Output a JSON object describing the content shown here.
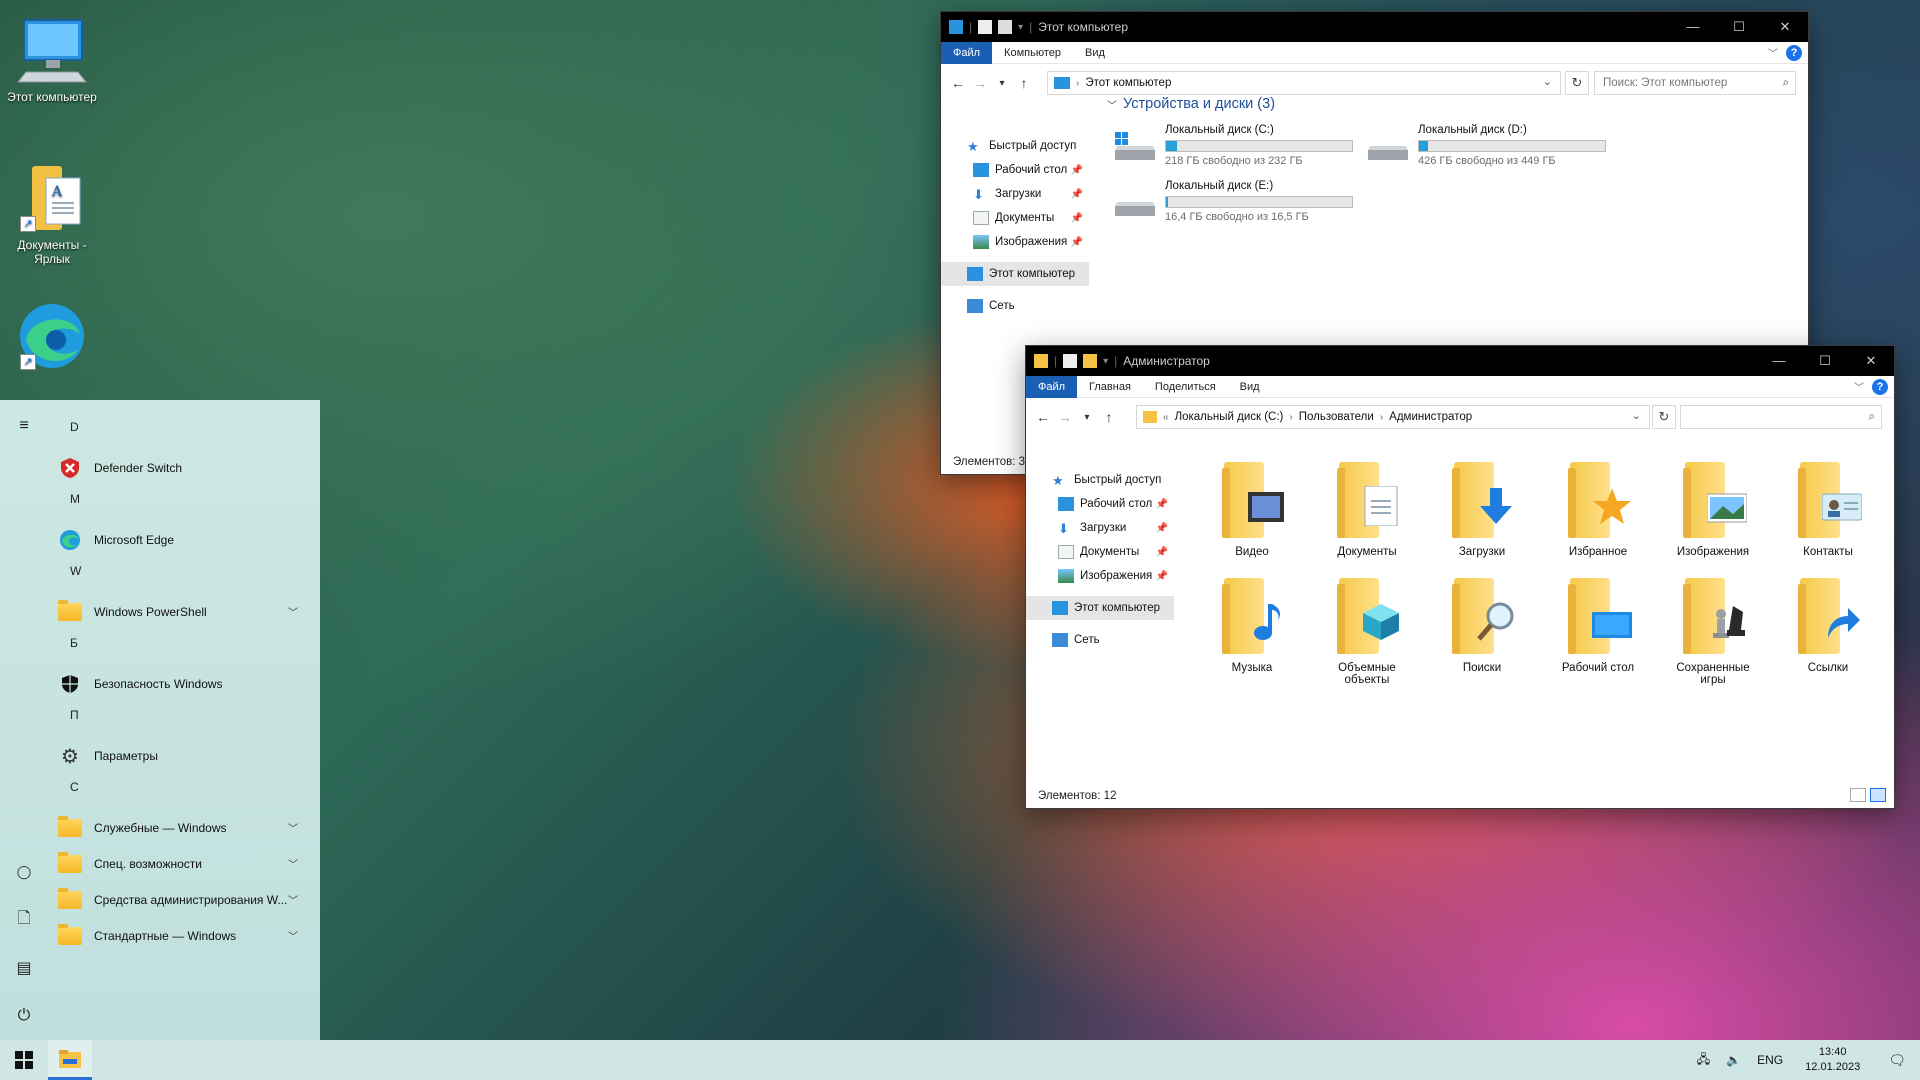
{
  "desktop": {
    "icons": [
      {
        "label": "Этот компьютер",
        "icon": "monitor-icon"
      },
      {
        "label": "Документы - Ярлык",
        "icon": "documents-folder-icon"
      },
      {
        "label": "",
        "icon": "edge-icon"
      }
    ]
  },
  "start_menu": {
    "groups": [
      {
        "letter": "D",
        "items": [
          {
            "label": "Defender Switch",
            "icon": "defender-switch-icon",
            "expandable": false
          }
        ]
      },
      {
        "letter": "M",
        "items": [
          {
            "label": "Microsoft Edge",
            "icon": "edge-icon",
            "expandable": false
          }
        ]
      },
      {
        "letter": "W",
        "items": [
          {
            "label": "Windows PowerShell",
            "icon": "folder-icon",
            "expandable": true
          }
        ]
      },
      {
        "letter": "Б",
        "items": [
          {
            "label": "Безопасность Windows",
            "icon": "shield-icon",
            "expandable": false
          }
        ]
      },
      {
        "letter": "П",
        "items": [
          {
            "label": "Параметры",
            "icon": "gear-icon",
            "expandable": false
          }
        ]
      },
      {
        "letter": "С",
        "items": [
          {
            "label": "Служебные — Windows",
            "icon": "folder-icon",
            "expandable": true
          },
          {
            "label": "Спец. возможности",
            "icon": "folder-icon",
            "expandable": true
          },
          {
            "label": "Средства администрирования W...",
            "icon": "folder-icon",
            "expandable": true
          },
          {
            "label": "Стандартные — Windows",
            "icon": "folder-icon",
            "expandable": true
          }
        ]
      }
    ]
  },
  "taskbar": {
    "language": "ENG",
    "time": "13:40",
    "date": "12.01.2023"
  },
  "window_computer": {
    "title": "Этот компьютер",
    "ribbon_tabs": [
      "Файл",
      "Компьютер",
      "Вид"
    ],
    "address": "Этот компьютер",
    "search_placeholder": "Поиск: Этот компьютер",
    "nav": {
      "quick_access": "Быстрый доступ",
      "pinned": [
        "Рабочий стол",
        "Загрузки",
        "Документы",
        "Изображения"
      ],
      "this_pc": "Этот компьютер",
      "network": "Сеть"
    },
    "group_header": "Устройства и диски (3)",
    "drives": [
      {
        "name": "Локальный диск (C:)",
        "free": "218 ГБ свободно из 232 ГБ",
        "used_fraction": 0.06
      },
      {
        "name": "Локальный диск (D:)",
        "free": "426 ГБ свободно из 449 ГБ",
        "used_fraction": 0.05
      },
      {
        "name": "Локальный диск (E:)",
        "free": "16,4 ГБ свободно из 16,5 ГБ",
        "used_fraction": 0.01
      }
    ],
    "status": "Элементов: 3"
  },
  "window_admin": {
    "title": "Администратор",
    "ribbon_tabs": [
      "Файл",
      "Главная",
      "Поделиться",
      "Вид"
    ],
    "breadcrumb": [
      "Локальный диск (C:)",
      "Пользователи",
      "Администратор"
    ],
    "nav": {
      "quick_access": "Быстрый доступ",
      "pinned": [
        "Рабочий стол",
        "Загрузки",
        "Документы",
        "Изображения"
      ],
      "this_pc": "Этот компьютер",
      "network": "Сеть"
    },
    "folders": [
      "Видео",
      "Документы",
      "Загрузки",
      "Избранное",
      "Изображения",
      "Контакты",
      "Музыка",
      "Объемные объекты",
      "Поиски",
      "Рабочий стол",
      "Сохраненные игры",
      "Ссылки"
    ],
    "status": "Элементов: 12"
  },
  "colors": {
    "accent": "#1a5fb4",
    "drive_bar": "#26a0da",
    "titlebar": "#000000"
  }
}
